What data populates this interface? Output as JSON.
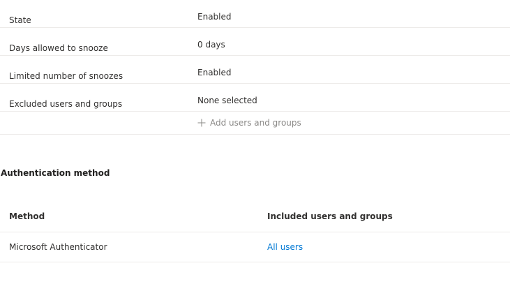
{
  "settings": {
    "rows": [
      {
        "label": "State",
        "value": "Enabled"
      },
      {
        "label": "Days allowed to snooze",
        "value": "0 days"
      },
      {
        "label": "Limited number of snoozes",
        "value": "Enabled"
      },
      {
        "label": "Excluded users and groups",
        "value": "None selected"
      }
    ],
    "add_label": "Add users and groups",
    "add_icon": "plus-icon"
  },
  "auth_method": {
    "title": "Authentication method",
    "headers": {
      "method": "Method",
      "included": "Included users and groups"
    },
    "rows": [
      {
        "method": "Microsoft Authenticator",
        "included": "All users"
      }
    ]
  },
  "colors": {
    "text": "#323130",
    "link": "#0078d4",
    "muted": "#8a8886",
    "divider": "#edebe9"
  }
}
